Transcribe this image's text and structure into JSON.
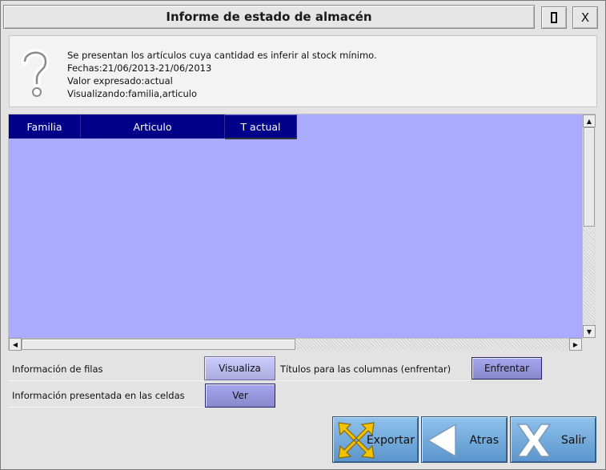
{
  "window": {
    "title": "Informe de estado de almacén",
    "close_label": "X"
  },
  "info": {
    "line1": "Se presentan los artículos cuya cantidad es inferir al stock mínimo.",
    "line2": "Fechas:21/06/2013-21/06/2013",
    "line3": "Valor expresado:actual",
    "line4": "Visualizando:familia,articulo",
    "icon": "question-icon"
  },
  "grid": {
    "columns": [
      "Familia",
      "Articulo",
      "T actual"
    ],
    "rows": [],
    "colors": {
      "header": "#000088",
      "body": "#aaaaff"
    }
  },
  "options": {
    "rows_label": "Información de filas",
    "rows_button": "Visualiza",
    "titles_label": "Títulos para las columnas (enfrentar)",
    "titles_button": "Enfrentar",
    "cells_label": "Información presentada en las celdas",
    "cells_button": "Ver"
  },
  "actions": {
    "export": "Exportar",
    "back": "Atras",
    "exit": "Salir"
  }
}
